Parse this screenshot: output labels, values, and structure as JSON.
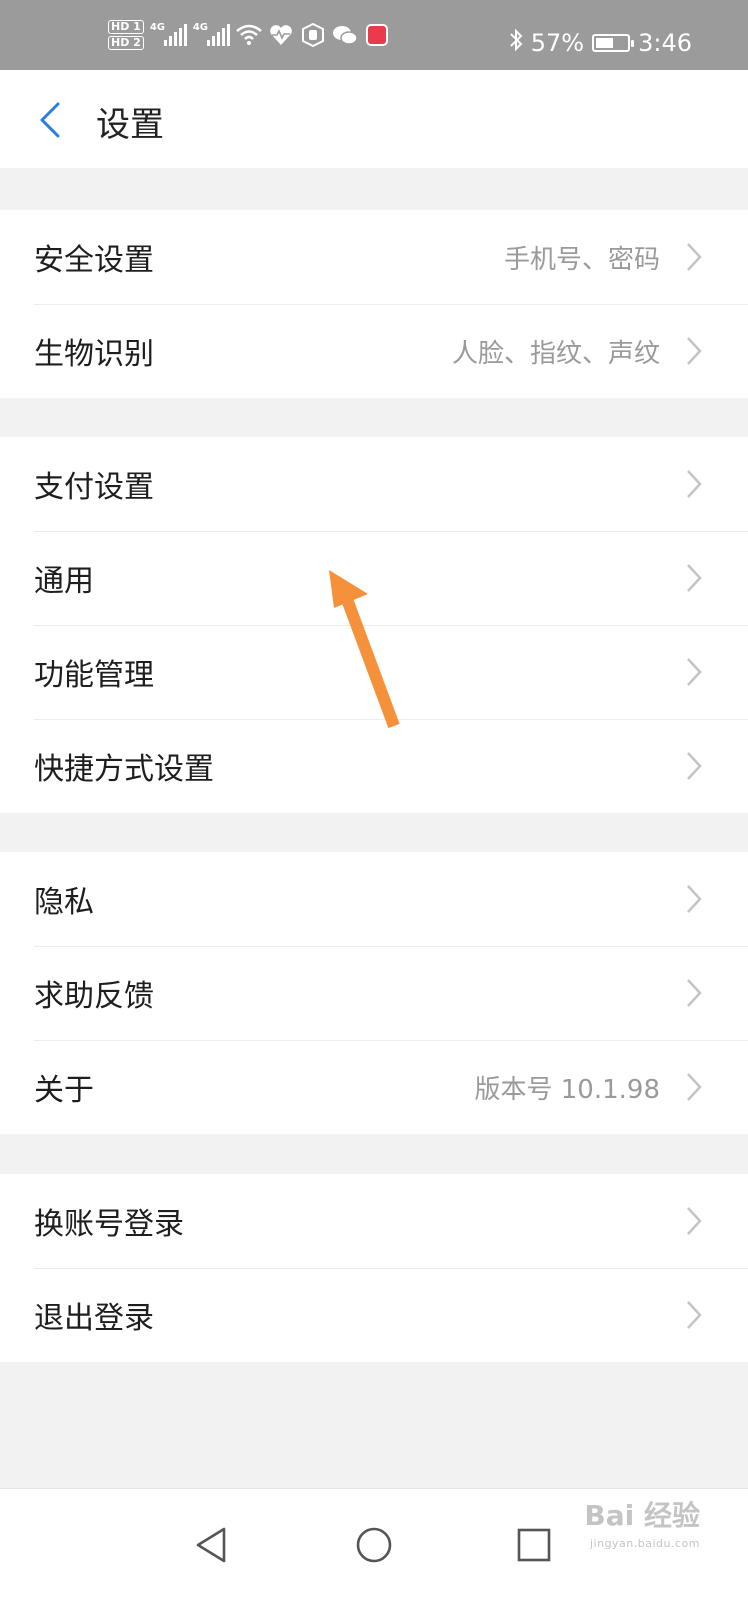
{
  "status_bar": {
    "hd1": "HD 1",
    "hd2": "HD 2",
    "net1": "4G",
    "net2": "4G",
    "battery_pct": "57%",
    "battery_level": 0.57,
    "time": "3:46",
    "icons": [
      "wifi-icon",
      "heart-rate-icon",
      "hand-icon",
      "wechat-icon",
      "app-icon",
      "bluetooth-icon",
      "battery-icon"
    ]
  },
  "header": {
    "title": "设置",
    "back_icon": "chevron-left-icon"
  },
  "groups": [
    {
      "items": [
        {
          "label": "安全设置",
          "value": "手机号、密码"
        },
        {
          "label": "生物识别",
          "value": "人脸、指纹、声纹"
        }
      ]
    },
    {
      "items": [
        {
          "label": "支付设置",
          "value": ""
        },
        {
          "label": "通用",
          "value": ""
        },
        {
          "label": "功能管理",
          "value": ""
        },
        {
          "label": "快捷方式设置",
          "value": ""
        }
      ]
    },
    {
      "items": [
        {
          "label": "隐私",
          "value": ""
        },
        {
          "label": "求助反馈",
          "value": ""
        },
        {
          "label": "关于",
          "value": "版本号 10.1.98"
        }
      ]
    },
    {
      "items": [
        {
          "label": "换账号登录",
          "value": ""
        },
        {
          "label": "退出登录",
          "value": ""
        }
      ]
    }
  ],
  "annotation": {
    "arrow_color": "#f5913a"
  },
  "navbar": {
    "buttons": [
      "nav-back-icon",
      "nav-home-icon",
      "nav-recents-icon"
    ]
  },
  "watermark": {
    "text": "Bai 经验",
    "url": "jingyan.baidu.com"
  },
  "colors": {
    "accent": "#2a7de1",
    "status_bar": "#9b9b9b",
    "background": "#f2f2f2"
  }
}
